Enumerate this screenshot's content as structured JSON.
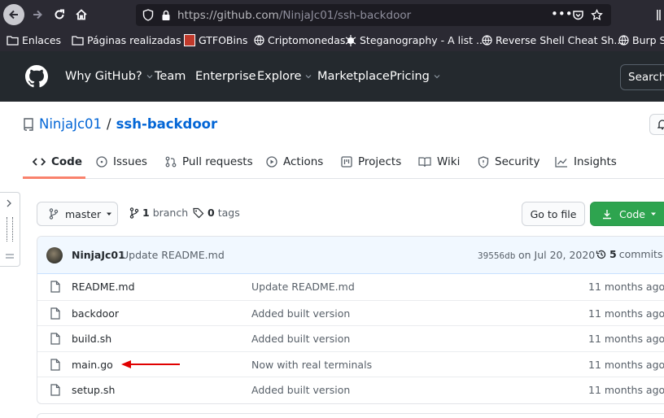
{
  "browser": {
    "url_host": "https://github.com",
    "url_path": "/NinjaJc01/ssh-backdoor",
    "bookmarks": [
      {
        "label": "Enlaces",
        "icon": "folder-icon"
      },
      {
        "label": "Páginas realizadas",
        "icon": "folder-icon"
      },
      {
        "label": "GTFOBins",
        "icon": "gtfobins-icon"
      },
      {
        "label": "Criptomonedas",
        "icon": "globe-icon"
      },
      {
        "label": "Steganography - A list ...",
        "icon": "spider-icon"
      },
      {
        "label": "Reverse Shell Cheat Sh...",
        "icon": "globe-icon"
      },
      {
        "label": "Burp Su",
        "icon": "globe-icon"
      }
    ]
  },
  "gh_nav": {
    "why": "Why GitHub?",
    "team": "Team",
    "enterprise": "Enterprise",
    "explore": "Explore",
    "marketplace": "Marketplace",
    "pricing": "Pricing",
    "search": "Search"
  },
  "repo": {
    "owner": "NinjaJc01",
    "separator": "/",
    "name": "ssh-backdoor"
  },
  "tabs": [
    "Code",
    "Issues",
    "Pull requests",
    "Actions",
    "Projects",
    "Wiki",
    "Security",
    "Insights"
  ],
  "branch_bar": {
    "branch_button": "master",
    "branch_count": "1",
    "branch_label": "branch",
    "tag_count": "0",
    "tag_label": "tags",
    "go_to_file": "Go to file",
    "code_button": "Code"
  },
  "commit": {
    "author": "NinjaJc01",
    "message": "Update README.md",
    "hash": "39556db",
    "date": "on Jul 20, 2020",
    "commit_count": "5",
    "commit_label": "commits"
  },
  "files": [
    {
      "name": "README.md",
      "message": "Update README.md",
      "age": "11 months ago"
    },
    {
      "name": "backdoor",
      "message": "Added built version",
      "age": "11 months ago"
    },
    {
      "name": "build.sh",
      "message": "Added built version",
      "age": "11 months ago"
    },
    {
      "name": "main.go",
      "message": "Now with real terminals",
      "age": "11 months ago"
    },
    {
      "name": "setup.sh",
      "message": "Added built version",
      "age": "11 months ago"
    }
  ],
  "colors": {
    "accent_link": "#0366d6",
    "tab_underline": "#f9826c",
    "code_button": "#2ea44f",
    "annotation_arrow": "#e00000"
  }
}
